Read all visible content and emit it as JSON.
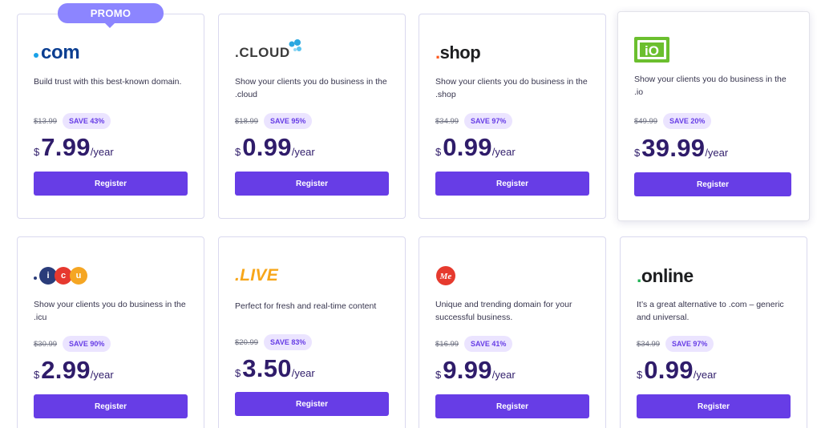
{
  "promo_badge": "PROMO",
  "colors": {
    "accent": "#673de6",
    "price_text": "#2f1c6a",
    "save_badge_bg": "#ebe4ff",
    "promo_bg": "#8c85ff"
  },
  "cards": [
    {
      "logo": {
        "text": "com",
        "icon": "com-logo"
      },
      "description": "Build trust with this best-known domain.",
      "old_price": "$13.99",
      "save": "SAVE 43%",
      "currency": "$",
      "price": "7.99",
      "period": "/year",
      "button": "Register"
    },
    {
      "logo": {
        "text": ".CLOUD",
        "icon": "cloud-logo"
      },
      "description": "Show your clients you do business in the .cloud",
      "old_price": "$18.99",
      "save": "SAVE 95%",
      "currency": "$",
      "price": "0.99",
      "period": "/year",
      "button": "Register"
    },
    {
      "logo": {
        "text": "shop",
        "icon": "shop-logo"
      },
      "description": "Show your clients you do business in the .shop",
      "old_price": "$34.99",
      "save": "SAVE 97%",
      "currency": "$",
      "price": "0.99",
      "period": "/year",
      "button": "Register"
    },
    {
      "logo": {
        "text": "iO",
        "icon": "io-logo"
      },
      "description": "Show your clients you do business in the .io",
      "old_price": "$49.99",
      "save": "SAVE 20%",
      "currency": "$",
      "price": "39.99",
      "period": "/year",
      "button": "Register"
    },
    {
      "logo": {
        "letters": [
          "i",
          "c",
          "u"
        ],
        "icon": "icu-logo"
      },
      "description": "Show your clients you do business in the .icu",
      "old_price": "$30.99",
      "save": "SAVE 90%",
      "currency": "$",
      "price": "2.99",
      "period": "/year",
      "button": "Register"
    },
    {
      "logo": {
        "text": ".LIVE",
        "icon": "live-logo"
      },
      "description": "Perfect for fresh and real-time content",
      "old_price": "$20.99",
      "save": "SAVE 83%",
      "currency": "$",
      "price": "3.50",
      "period": "/year",
      "button": "Register"
    },
    {
      "logo": {
        "text": "Me",
        "icon": "me-logo"
      },
      "description": "Unique and trending domain for your successful business.",
      "old_price": "$16.99",
      "save": "SAVE 41%",
      "currency": "$",
      "price": "9.99",
      "period": "/year",
      "button": "Register"
    },
    {
      "logo": {
        "text": "online",
        "icon": "online-logo"
      },
      "description": "It’s a great alternative to .com – generic and universal.",
      "old_price": "$34.99",
      "save": "SAVE 97%",
      "currency": "$",
      "price": "0.99",
      "period": "/year",
      "button": "Register"
    }
  ]
}
